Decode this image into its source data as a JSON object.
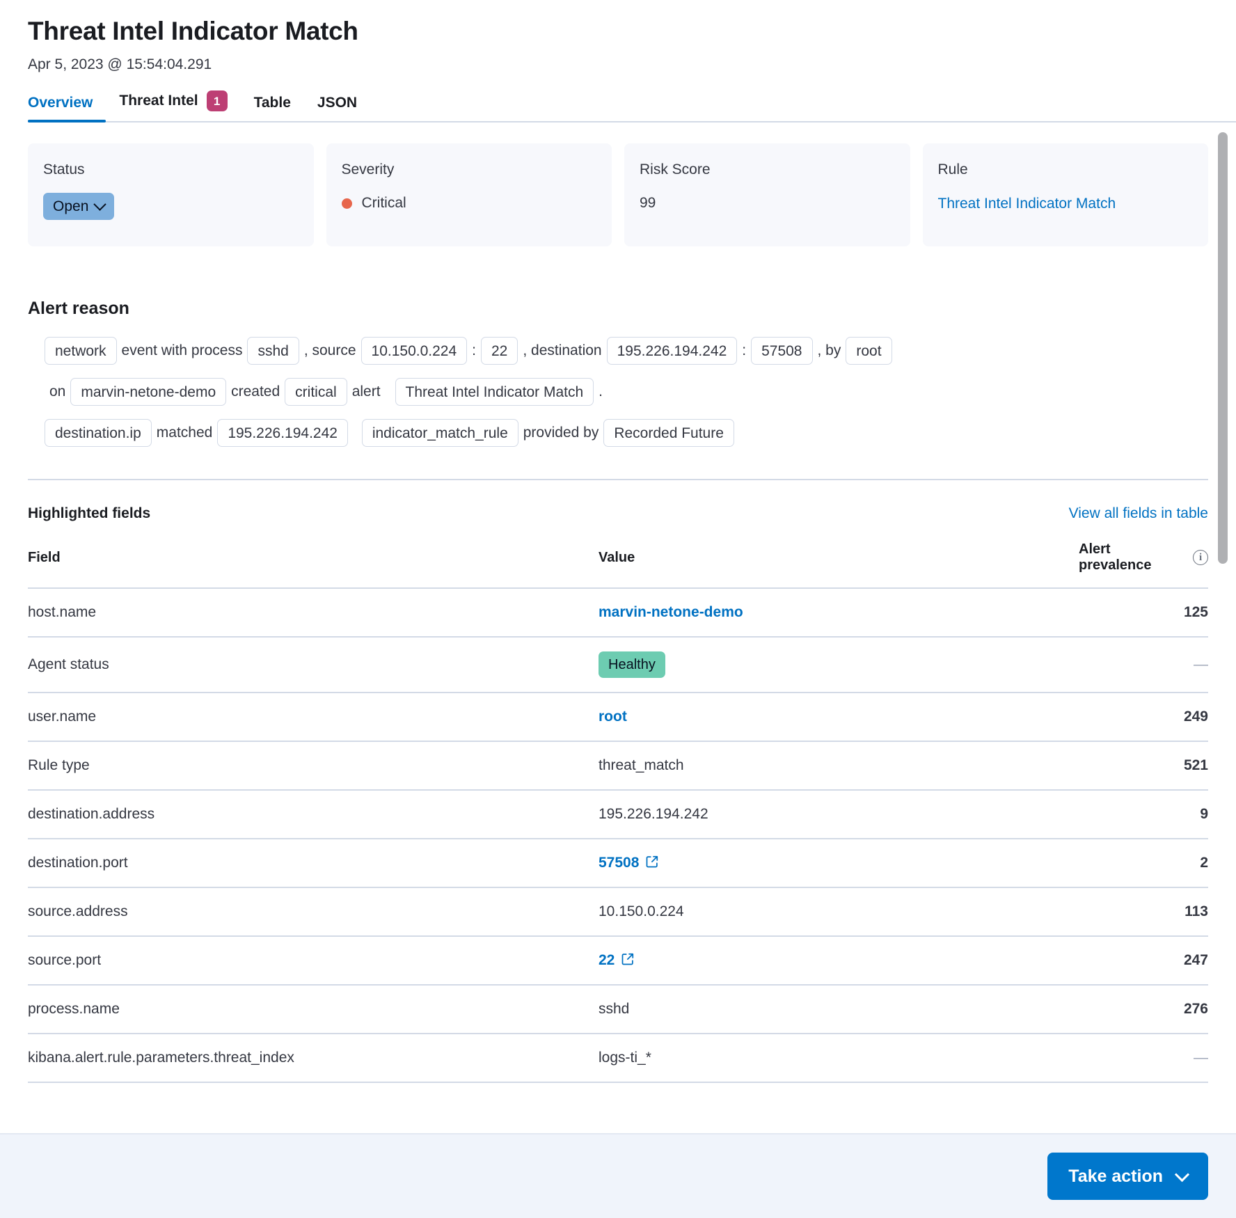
{
  "header": {
    "title": "Threat Intel Indicator Match",
    "timestamp": "Apr 5, 2023 @ 15:54:04.291"
  },
  "tabs": [
    {
      "label": "Overview",
      "badge": null,
      "active": true
    },
    {
      "label": "Threat Intel",
      "badge": "1",
      "active": false
    },
    {
      "label": "Table",
      "badge": null,
      "active": false
    },
    {
      "label": "JSON",
      "badge": null,
      "active": false
    }
  ],
  "summary": {
    "status": {
      "label": "Status",
      "value": "Open"
    },
    "severity": {
      "label": "Severity",
      "value": "Critical",
      "color": "#e7664c"
    },
    "risk_score": {
      "label": "Risk Score",
      "value": "99"
    },
    "rule": {
      "label": "Rule",
      "value": "Threat Intel Indicator Match"
    }
  },
  "alert_reason": {
    "heading": "Alert reason",
    "line1": {
      "chip_event": "network",
      "t1": "event with process",
      "chip_process": "sshd",
      "t2": ", source",
      "chip_source_ip": "10.150.0.224",
      "t3": ":",
      "chip_source_port": "22",
      "t4": ", destination",
      "chip_dest_ip": "195.226.194.242",
      "t5": ":",
      "chip_dest_port": "57508",
      "t6": ", by",
      "chip_user": "root"
    },
    "line2": {
      "t1": "on",
      "chip_host": "marvin-netone-demo",
      "t2": "created",
      "chip_severity": "critical",
      "t3": "alert",
      "chip_rule": "Threat Intel Indicator Match",
      "t4": "."
    },
    "line3": {
      "chip_field": "destination.ip",
      "t1": "matched",
      "chip_value": "195.226.194.242",
      "chip_rule_type": "indicator_match_rule",
      "t2": "provided by",
      "chip_provider": "Recorded Future"
    }
  },
  "highlighted_fields": {
    "title": "Highlighted fields",
    "view_all_link": "View all fields in table",
    "columns": {
      "field": "Field",
      "value": "Value",
      "prevalence": "Alert prevalence"
    },
    "rows": [
      {
        "field": "host.name",
        "value": "marvin-netone-demo",
        "value_style": "link",
        "external": false,
        "prevalence": "125"
      },
      {
        "field": "Agent status",
        "value": "Healthy",
        "value_style": "badge",
        "external": false,
        "prevalence": "—",
        "prevalence_muted": true
      },
      {
        "field": "user.name",
        "value": "root",
        "value_style": "link",
        "external": false,
        "prevalence": "249"
      },
      {
        "field": "Rule type",
        "value": "threat_match",
        "value_style": "plain",
        "external": false,
        "prevalence": "521"
      },
      {
        "field": "destination.address",
        "value": "195.226.194.242",
        "value_style": "plain",
        "external": false,
        "prevalence": "9"
      },
      {
        "field": "destination.port",
        "value": "57508",
        "value_style": "link",
        "external": true,
        "prevalence": "2"
      },
      {
        "field": "source.address",
        "value": "10.150.0.224",
        "value_style": "plain",
        "external": false,
        "prevalence": "113"
      },
      {
        "field": "source.port",
        "value": "22",
        "value_style": "link",
        "external": true,
        "prevalence": "247"
      },
      {
        "field": "process.name",
        "value": "sshd",
        "value_style": "plain",
        "external": false,
        "prevalence": "276"
      },
      {
        "field": "kibana.alert.rule.parameters.threat_index",
        "value": "logs-ti_*",
        "value_style": "plain",
        "external": false,
        "prevalence": "—",
        "prevalence_muted": true
      }
    ]
  },
  "footer": {
    "take_action": "Take action"
  },
  "icons": {
    "chevron_down": "chevron-down-icon",
    "external_link": "external-link-icon",
    "info": "info-icon"
  },
  "colors": {
    "accent": "#0071c2",
    "badge_pink": "#bd3f74",
    "severity_critical": "#e7664c",
    "healthy_green": "#6dccb1",
    "status_blue": "#7eafdd",
    "button_blue": "#0077cc"
  }
}
